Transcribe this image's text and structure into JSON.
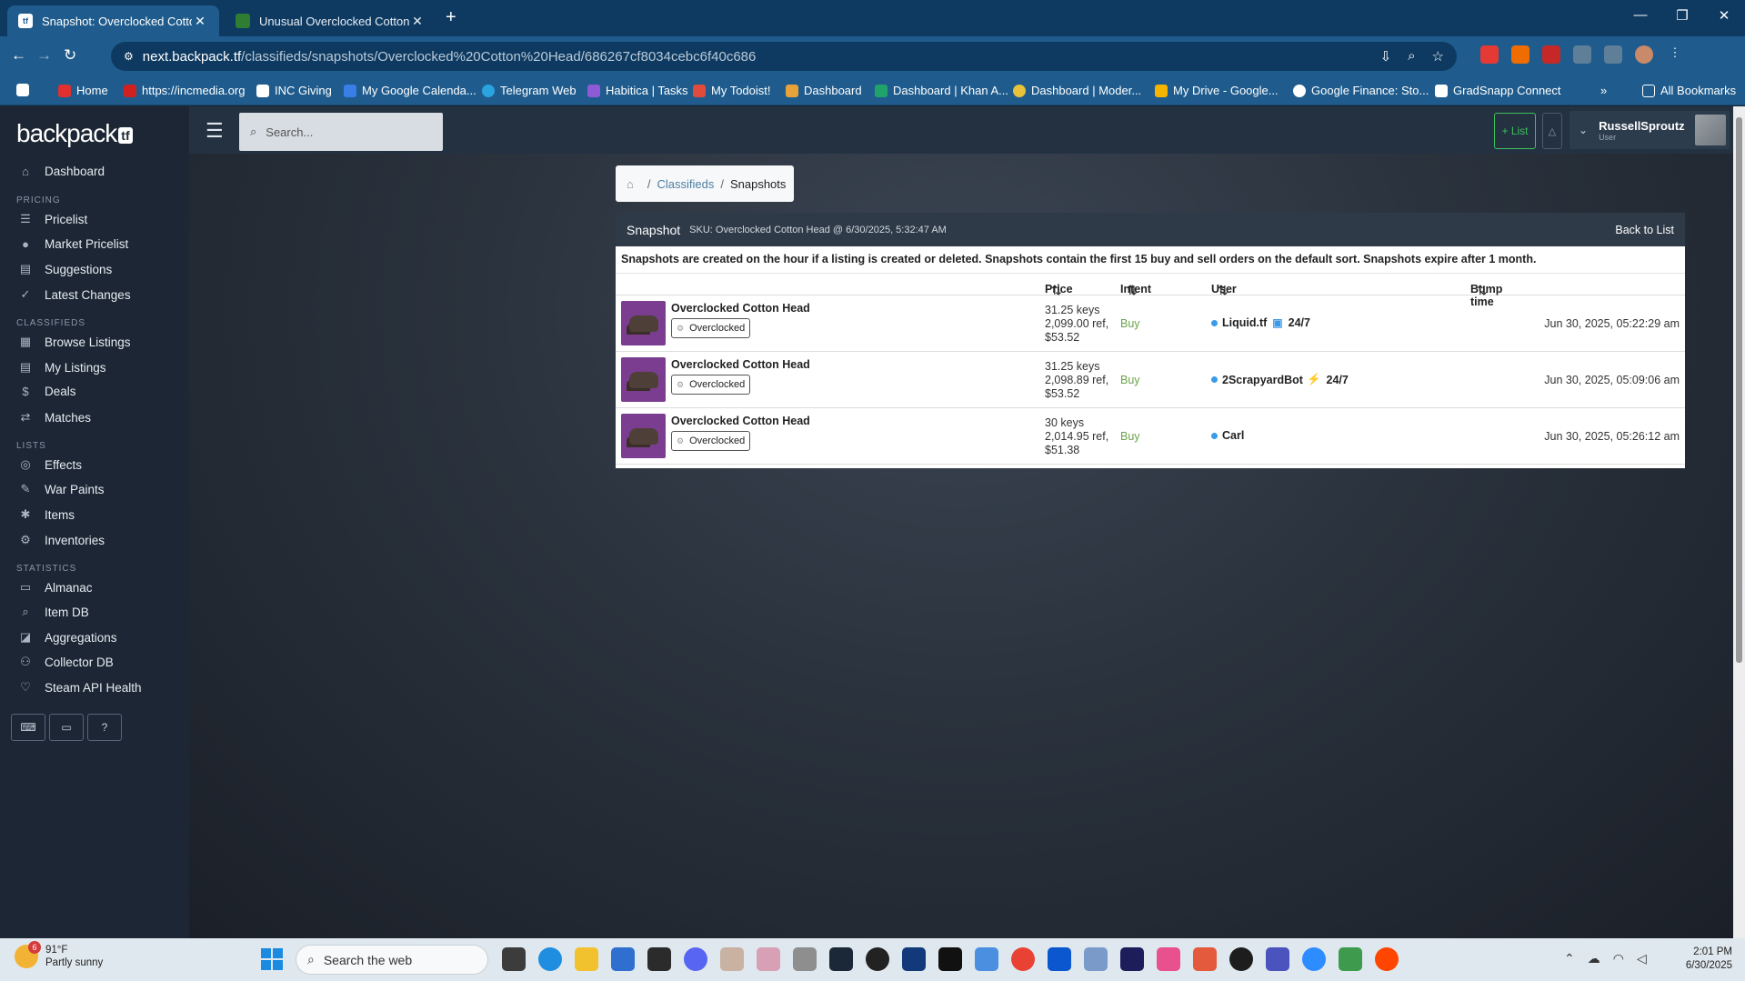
{
  "browser": {
    "tabs": [
      {
        "title": "Snapshot: Overclocked Cotton H",
        "active": true
      },
      {
        "title": "Unusual Overclocked Cotton He",
        "active": false
      }
    ],
    "url_host": "next.backpack.tf",
    "url_path": "/classifieds/snapshots/Overclocked%20Cotton%20Head/686267cf8034cebc6f40c686",
    "bookmarks": [
      {
        "label": "Home",
        "color": "#e03030"
      },
      {
        "label": "https://incmedia.org",
        "color": "#d02020"
      },
      {
        "label": "INC Giving",
        "color": "#ffffff"
      },
      {
        "label": "My Google Calenda...",
        "color": "#3a7ee8"
      },
      {
        "label": "Telegram Web",
        "color": "#2aa3e0"
      },
      {
        "label": "Habitica | Tasks",
        "color": "#8f5ad6"
      },
      {
        "label": "My Todoist!",
        "color": "#e04b3c"
      },
      {
        "label": "Dashboard",
        "color": "#e7a23a"
      },
      {
        "label": "Dashboard | Khan A...",
        "color": "#1fa36b"
      },
      {
        "label": "Dashboard | Moder...",
        "color": "#e8c23a"
      },
      {
        "label": "My Drive - Google...",
        "color": "#f4b400"
      },
      {
        "label": "Google Finance: Sto...",
        "color": "#ffffff"
      },
      {
        "label": "GradSnapp Connect",
        "color": "#ffffff"
      }
    ],
    "all_bookmarks": "All Bookmarks"
  },
  "sidebar": {
    "logo": "backpack",
    "logo_tf": "tf",
    "dashboard": "Dashboard",
    "sections": [
      {
        "title": "PRICING",
        "items": [
          "Pricelist",
          "Market Pricelist",
          "Suggestions",
          "Latest Changes"
        ]
      },
      {
        "title": "CLASSIFIEDS",
        "items": [
          "Browse Listings",
          "My Listings",
          "Deals",
          "Matches"
        ]
      },
      {
        "title": "LISTS",
        "items": [
          "Effects",
          "War Paints",
          "Items",
          "Inventories"
        ]
      },
      {
        "title": "STATISTICS",
        "items": [
          "Almanac",
          "Item DB",
          "Aggregations",
          "Collector DB",
          "Steam API Health"
        ]
      }
    ]
  },
  "topnav": {
    "search_placeholder": "Search...",
    "list_button": "+ List",
    "username": "RussellSproutz",
    "role": "User"
  },
  "breadcrumb": {
    "classifieds": "Classifieds",
    "current": "Snapshots"
  },
  "snapshot": {
    "title": "Snapshot",
    "sku": "SKU: Overclocked Cotton Head @ 6/30/2025, 5:32:47 AM",
    "back": "Back to List",
    "notice": "Snapshots are created on the hour if a listing is created or deleted. Snapshots contain the first 15 buy and sell orders on the default sort. Snapshots expire after 1 month.",
    "columns": {
      "price": "Price",
      "intent": "Intent",
      "user": "User",
      "bump": "Bump time"
    },
    "rows": [
      {
        "item": "Overclocked Cotton Head",
        "tag": "Overclocked",
        "price1": "31.25 keys",
        "price2": "2,099.00 ref,",
        "price3": "$53.52",
        "intent": "Buy",
        "user": "Liquid.tf",
        "user_suffix": "24/7",
        "bump": "Jun 30, 2025, 05:22:29 am"
      },
      {
        "item": "Overclocked Cotton Head",
        "tag": "Overclocked",
        "price1": "31.25 keys",
        "price2": "2,098.89 ref,",
        "price3": "$53.52",
        "intent": "Buy",
        "user": "2ScrapyardBot",
        "user_suffix": "24/7",
        "bump": "Jun 30, 2025, 05:09:06 am"
      },
      {
        "item": "Overclocked Cotton Head",
        "tag": "Overclocked",
        "price1": "30 keys",
        "price2": "2,014.95 ref,",
        "price3": "$51.38",
        "intent": "Buy",
        "user": "Carl",
        "user_suffix": "",
        "bump": "Jun 30, 2025, 05:26:12 am"
      }
    ]
  },
  "taskbar": {
    "temp": "91°F",
    "weather": "Partly sunny",
    "weather_badge": "6",
    "search": "Search the web",
    "time": "2:01 PM",
    "date": "6/30/2025"
  }
}
